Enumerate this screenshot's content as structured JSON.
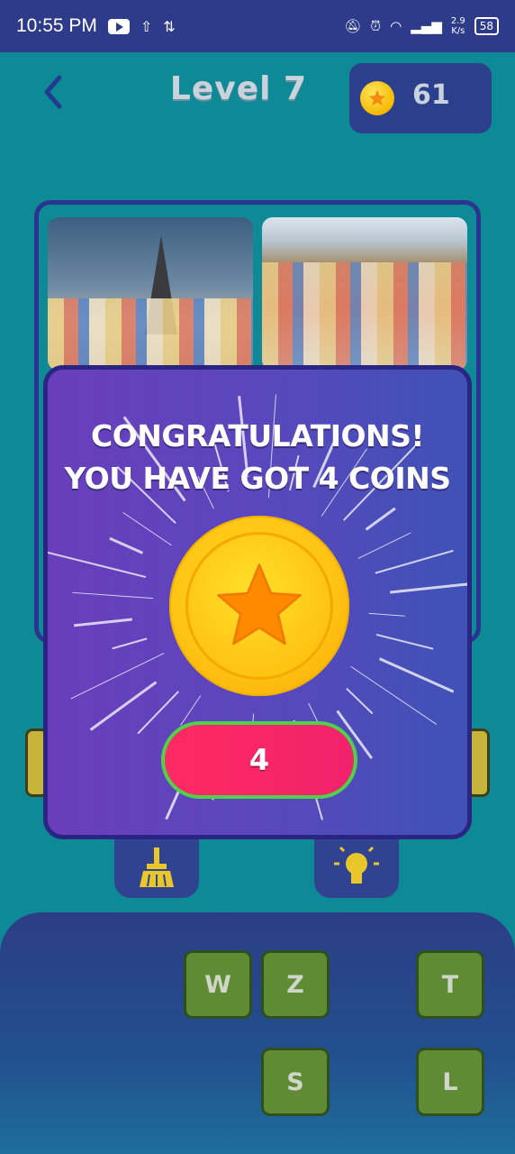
{
  "status_bar": {
    "time": "10:55 PM",
    "speed_top": "2.9",
    "speed_unit": "K/s",
    "battery": "58"
  },
  "header": {
    "back_icon": "chevron-left-icon",
    "title": "Level 7",
    "coins": "61"
  },
  "popup": {
    "line1": "CONGRATULATIONS!",
    "line2": "YOU HAVE GOT 4 COINS",
    "reward_label": "4"
  },
  "tools": {
    "broom_icon": "broom-icon",
    "hint_icon": "lightbulb-icon"
  },
  "letters": [
    "W",
    "Z",
    "T",
    "S",
    "L"
  ],
  "colors": {
    "background": "#0e8a96",
    "popup": "#5a47bd",
    "reward_button": "#f0226c",
    "key": "#5e8b33",
    "coin": "#ffc414"
  }
}
